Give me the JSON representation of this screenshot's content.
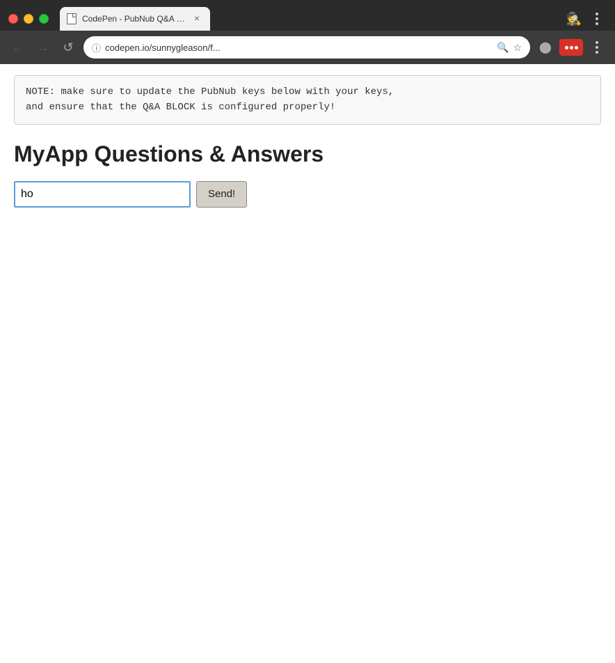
{
  "browser": {
    "tab": {
      "title": "CodePen - PubNub Q&A UI w/",
      "favicon": "doc"
    },
    "address_bar": {
      "url": "codepen.io/sunnygleason/f...",
      "full_url": "codepen.io/sunnygleason/f..."
    },
    "nav": {
      "back_label": "←",
      "forward_label": "→",
      "reload_label": "↺"
    }
  },
  "note": {
    "text_line1": "NOTE: make sure to update the PubNub keys below with your keys,",
    "text_line2": "and ensure that the Q&A BLOCK is configured properly!"
  },
  "page": {
    "title": "MyApp Questions & Answers",
    "input": {
      "value": "ho",
      "placeholder": ""
    },
    "send_button_label": "Send!"
  }
}
